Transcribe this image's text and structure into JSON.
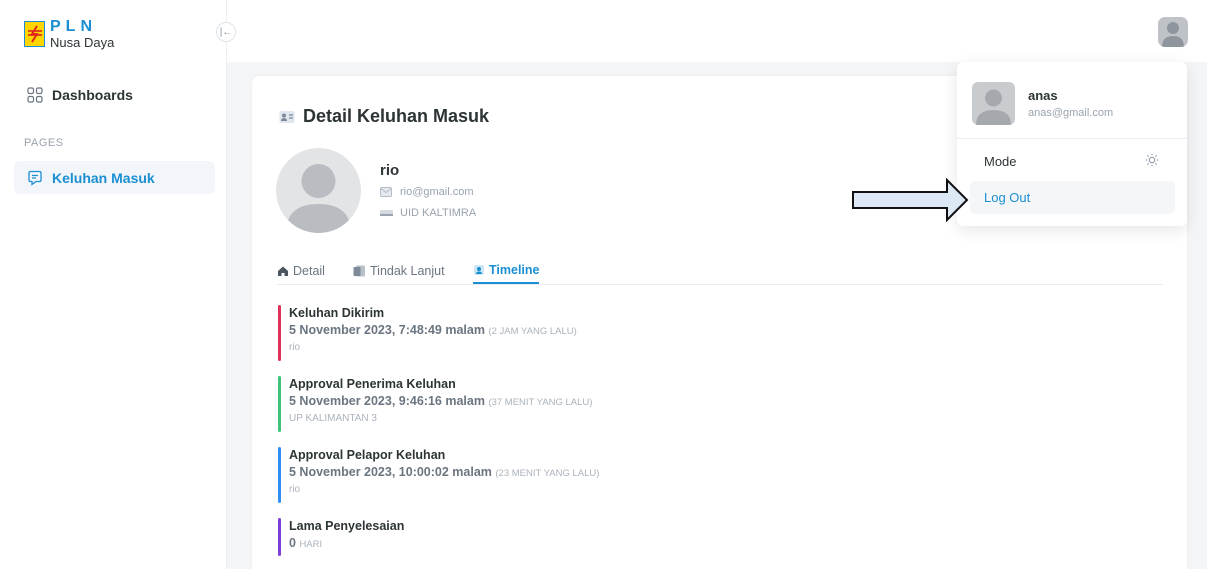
{
  "brand": {
    "name": "PLN",
    "subtitle": "Nusa Daya"
  },
  "sidebar": {
    "dashboards_label": "Dashboards",
    "section_label": "PAGES",
    "keluhan_label": "Keluhan Masuk"
  },
  "page": {
    "title": "Detail Keluhan Masuk"
  },
  "profile": {
    "name": "rio",
    "email": "rio@gmail.com",
    "unit": "UID KALTIMRA"
  },
  "tabs": [
    {
      "label": "Detail",
      "icon": "home-icon",
      "active": false
    },
    {
      "label": "Tindak Lanjut",
      "icon": "document-icon",
      "active": false
    },
    {
      "label": "Timeline",
      "icon": "timeline-icon",
      "active": true
    }
  ],
  "timeline": [
    {
      "title": "Keluhan Dikirim",
      "time": "5 November 2023, 7:48:49 malam",
      "relative": "(2 JAM YANG LALU)",
      "by": "rio",
      "color": "#e0315a"
    },
    {
      "title": "Approval Penerima Keluhan",
      "time": "5 November 2023, 9:46:16 malam",
      "relative": "(37 MENIT YANG LALU)",
      "by": "UP KALIMANTAN 3",
      "color": "#3fc27a"
    },
    {
      "title": "Approval Pelapor Keluhan",
      "time": "5 November 2023, 10:00:02 malam",
      "relative": "(23 MENIT YANG LALU)",
      "by": "rio",
      "color": "#2f8ff0"
    },
    {
      "title": "Lama Penyelesaian",
      "time": "0",
      "relative": "HARI",
      "by": "",
      "color": "#7b3fd6"
    }
  ],
  "user_menu": {
    "name": "anas",
    "email": "anas@gmail.com",
    "mode_label": "Mode",
    "logout_label": "Log Out"
  },
  "colors": {
    "accent": "#1b8fd1",
    "brand_yellow": "#ffd500"
  }
}
